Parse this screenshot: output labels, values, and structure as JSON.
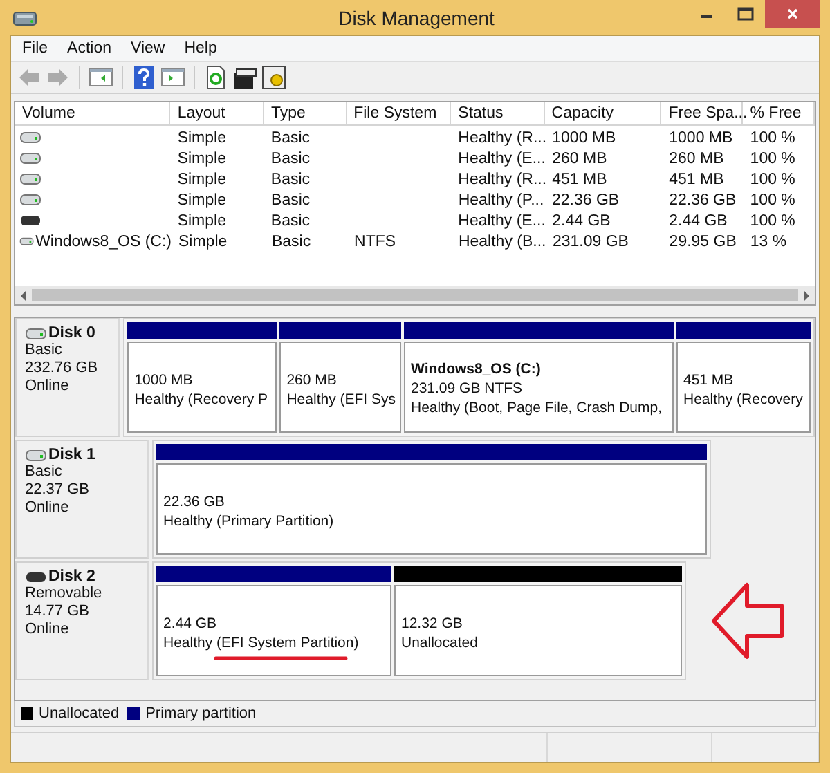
{
  "window": {
    "title": "Disk Management"
  },
  "menu": [
    "File",
    "Action",
    "View",
    "Help"
  ],
  "toolbar": [
    {
      "kind": "back",
      "disabled": true
    },
    {
      "kind": "forward",
      "disabled": true
    },
    {
      "kind": "separator"
    },
    {
      "kind": "console-tree",
      "disabled": false
    },
    {
      "kind": "separator"
    },
    {
      "kind": "help",
      "disabled": false
    },
    {
      "kind": "action-pane",
      "disabled": false
    },
    {
      "kind": "separator"
    },
    {
      "kind": "refresh",
      "disabled": false
    },
    {
      "kind": "rescan",
      "disabled": false
    },
    {
      "kind": "properties",
      "disabled": false
    }
  ],
  "volume_table": {
    "columns": [
      "Volume",
      "Layout",
      "Type",
      "File System",
      "Status",
      "Capacity",
      "Free Spa...",
      "% Free"
    ],
    "rows": [
      {
        "kind": "fixed",
        "cells": [
          "",
          "Simple",
          "Basic",
          "",
          "Healthy (R...",
          "1000 MB",
          "1000 MB",
          "100 %"
        ]
      },
      {
        "kind": "fixed",
        "cells": [
          "",
          "Simple",
          "Basic",
          "",
          "Healthy (E...",
          "260 MB",
          "260 MB",
          "100 %"
        ]
      },
      {
        "kind": "fixed",
        "cells": [
          "",
          "Simple",
          "Basic",
          "",
          "Healthy (R...",
          "451 MB",
          "451 MB",
          "100 %"
        ]
      },
      {
        "kind": "fixed",
        "cells": [
          "",
          "Simple",
          "Basic",
          "",
          "Healthy (P...",
          "22.36 GB",
          "22.36 GB",
          "100 %"
        ]
      },
      {
        "kind": "removable",
        "cells": [
          "",
          "Simple",
          "Basic",
          "",
          "Healthy (E...",
          "2.44 GB",
          "2.44 GB",
          "100 %"
        ]
      },
      {
        "kind": "fixed",
        "cells": [
          "Windows8_OS (C:)",
          "Simple",
          "Basic",
          "NTFS",
          "Healthy (B...",
          "231.09 GB",
          "29.95 GB",
          "13 %"
        ]
      }
    ]
  },
  "disks": [
    {
      "name": "Disk 0",
      "kind": "fixed",
      "type": "Basic",
      "size": "232.76 GB",
      "state": "Online",
      "partitions": [
        {
          "kind": "primary",
          "size": "1000 MB",
          "status": "Healthy (Recovery P"
        },
        {
          "kind": "primary",
          "size": "260 MB",
          "status": "Healthy (EFI Sys"
        },
        {
          "kind": "primary",
          "label": "Windows8_OS  (C:)",
          "size": "231.09 GB NTFS",
          "status": "Healthy (Boot, Page File, Crash Dump,"
        },
        {
          "kind": "primary",
          "size": "451 MB",
          "status": "Healthy (Recovery"
        }
      ]
    },
    {
      "name": "Disk 1",
      "kind": "fixed",
      "type": "Basic",
      "size": "22.37 GB",
      "state": "Online",
      "partitions": [
        {
          "kind": "primary",
          "size": "22.36 GB",
          "status": "Healthy (Primary Partition)"
        }
      ]
    },
    {
      "name": "Disk 2",
      "kind": "removable",
      "type": "Removable",
      "size": "14.77 GB",
      "state": "Online",
      "partitions": [
        {
          "kind": "primary",
          "size": "2.44 GB",
          "status": "Healthy (EFI System Partition)",
          "underlined": true
        },
        {
          "kind": "unallocated",
          "size": "12.32 GB",
          "status": "Unallocated"
        }
      ],
      "arrow": true
    }
  ],
  "legend": [
    {
      "kind": "unallocated",
      "label": "Unallocated"
    },
    {
      "kind": "primary",
      "label": "Primary partition"
    }
  ]
}
